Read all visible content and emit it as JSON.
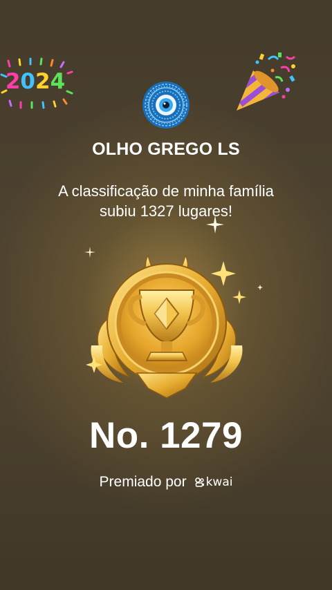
{
  "sticker": {
    "year_digits": [
      "2",
      "0",
      "2",
      "4"
    ],
    "icon": "fireworks-2024-icon"
  },
  "decoration": {
    "icon": "party-popper-icon"
  },
  "profile": {
    "avatar_icon": "evil-eye-icon",
    "name": "OLHO GREGO LS"
  },
  "message": {
    "line1": "A classificação de minha família",
    "line2": "subiu 1327 lugares!"
  },
  "award": {
    "icon": "gold-trophy-badge-icon",
    "rank_text": "No. 1279",
    "awarded_by_label": "Premiado por",
    "brand": "kwai"
  },
  "colors": {
    "background": "#4a3f2c",
    "gold": "#e8b838",
    "text": "#ffffff"
  }
}
